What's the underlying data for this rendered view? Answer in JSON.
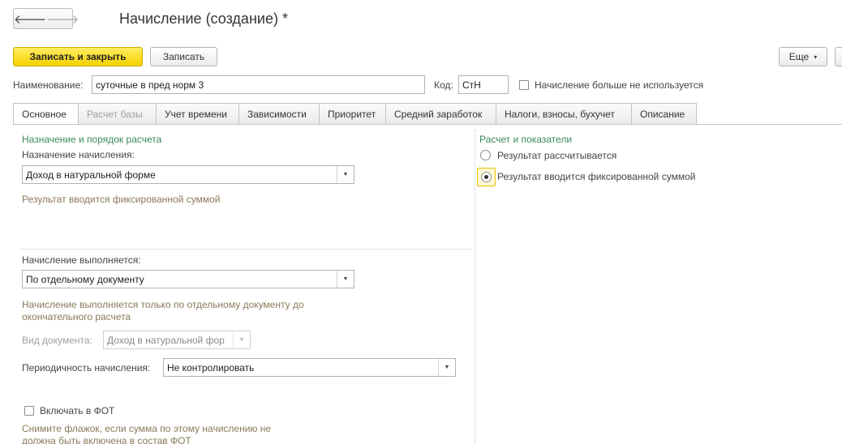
{
  "header": {
    "title": "Начисление (создание) *",
    "back_arrow": "🡐",
    "forward_arrow": "🡒"
  },
  "toolbar": {
    "save_close_label": "Записать и закрыть",
    "save_label": "Записать",
    "more_label": "Еще",
    "more_arrow": "▾"
  },
  "fields": {
    "name_label": "Наименование:",
    "name_value": "суточные в пред норм 3",
    "code_label": "Код:",
    "code_value": "СтН",
    "unused_label": "Начисление больше не используется"
  },
  "tabs": [
    {
      "label": "Основное"
    },
    {
      "label": "Расчет базы"
    },
    {
      "label": "Учет времени"
    },
    {
      "label": "Зависимости"
    },
    {
      "label": "Приоритет"
    },
    {
      "label": "Средний заработок"
    },
    {
      "label": "Налоги, взносы, бухучет"
    },
    {
      "label": "Описание"
    }
  ],
  "left_panel": {
    "section_title": "Назначение и порядок расчета",
    "purpose_label": "Назначение начисления:",
    "purpose_value": "Доход в натуральной форме",
    "purpose_hint": "Результат вводится фиксированной суммой",
    "execution_label": "Начисление выполняется:",
    "execution_value": "По отдельному документу",
    "execution_hint_line1": "Начисление выполняется только по отдельному документу до",
    "execution_hint_line2": "окончательного расчета",
    "doc_type_label": "Вид документа:",
    "doc_type_value": "Доход в натуральной фор",
    "periodicity_label": "Периодичность начисления:",
    "periodicity_value": "Не контролировать",
    "fot_label": "Включать в ФОТ",
    "fot_hint_line1": "Снимите флажок, если сумма по этому начислению не",
    "fot_hint_line2": "должна быть включена в состав ФОТ"
  },
  "right_panel": {
    "section_title": "Расчет и показатели",
    "option_calculated": "Результат рассчитывается",
    "option_fixed": "Результат вводится фиксированной суммой"
  },
  "dropdown_arrow": "▼"
}
